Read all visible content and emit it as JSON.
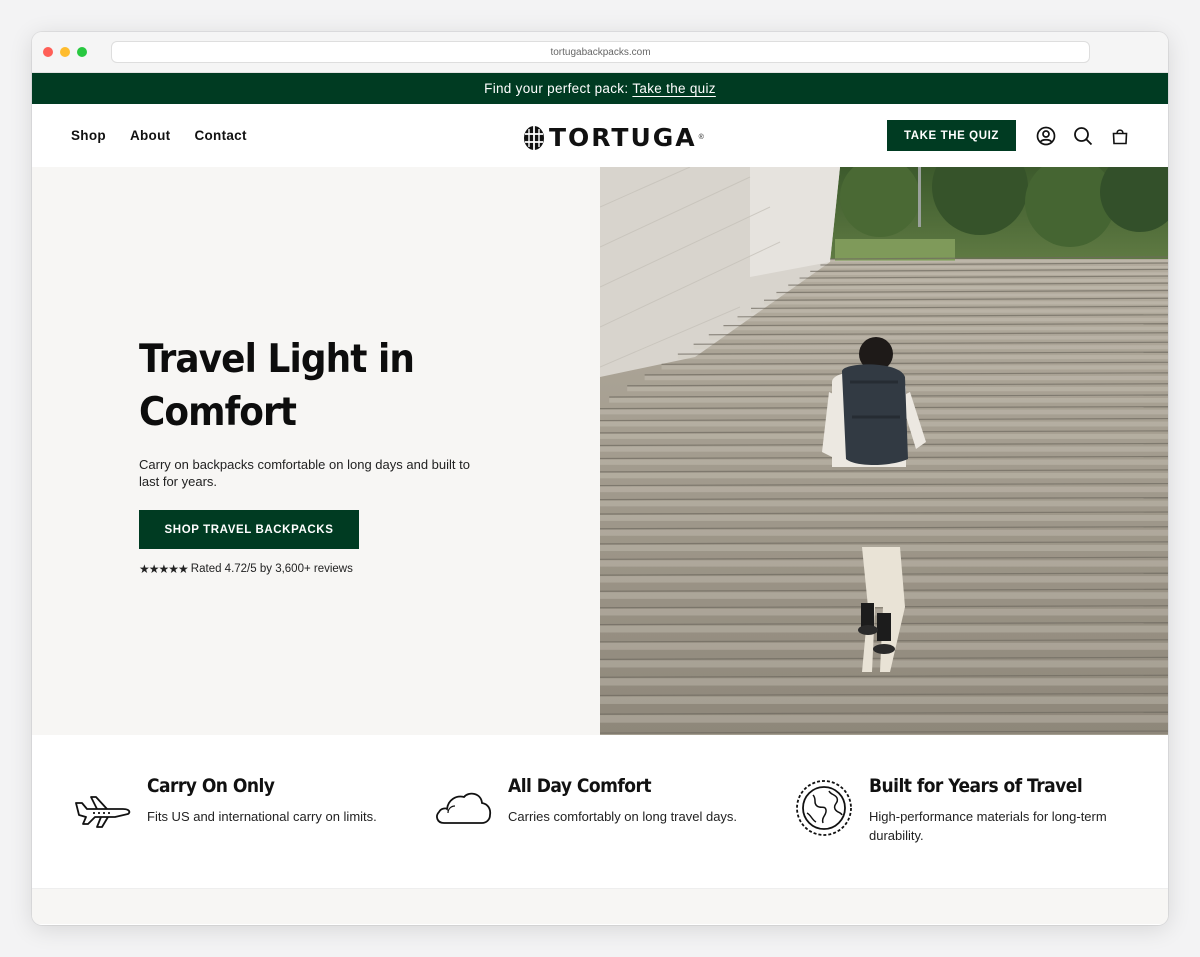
{
  "browser": {
    "url": "tortugabackpacks.com",
    "dot_colors": [
      "#ff5f57",
      "#febc2e",
      "#28c840"
    ]
  },
  "announcement": {
    "text": "Find your perfect pack:",
    "link": "Take the quiz"
  },
  "header": {
    "nav": [
      "Shop",
      "About",
      "Contact"
    ],
    "logo": "TORTUGA",
    "cta": "TAKE THE QUIZ",
    "icons": [
      "account-icon",
      "search-icon",
      "cart-icon"
    ]
  },
  "hero": {
    "title": "Travel Light in Comfort",
    "subtitle": "Carry on backpacks comfortable on long days and built to last for years.",
    "cta": "SHOP TRAVEL BACKPACKS",
    "stars": "★★★★★",
    "rating": "Rated 4.72/5 by 3,600+ reviews"
  },
  "features": [
    {
      "icon": "airplane-icon",
      "title": "Carry On Only",
      "desc": "Fits US and international carry on limits."
    },
    {
      "icon": "cloud-icon",
      "title": "All Day Comfort",
      "desc": "Carries comfortably on long travel days."
    },
    {
      "icon": "globe-icon",
      "title": "Built for Years of Travel",
      "desc": "High-performance materials for long-term durability."
    }
  ],
  "colors": {
    "brand_green": "#003b22",
    "hero_bg": "#f7f6f4"
  }
}
